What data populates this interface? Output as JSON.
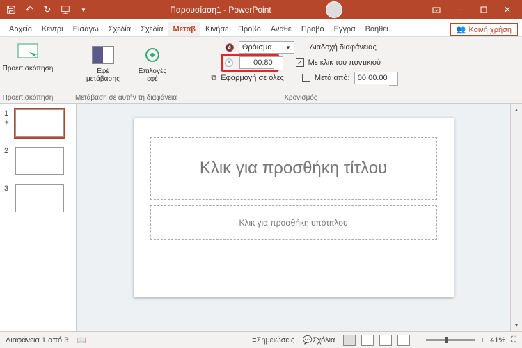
{
  "titlebar": {
    "title": "Παρουσίαση1 - PowerPoint"
  },
  "tabs": {
    "items": [
      "Αρχείο",
      "Κεντρι",
      "Εισαγω",
      "Σχεδία",
      "Σχεδία",
      "Μεταβ",
      "Κινήσε",
      "Προβο",
      "Αναθε",
      "Προβο",
      "Εγγρα",
      "Βοήθει"
    ],
    "active_index": 5,
    "share": "Κοινή χρήση"
  },
  "ribbon": {
    "preview": {
      "label": "Προεπισκόπηση",
      "group": "Προεπισκόπηση"
    },
    "trans_group": "Μετάβαση σε αυτήν τη διαφάνεια",
    "effect_opts": "Εφέ\nμετάβασης",
    "options": "Επιλογές\nεφέ",
    "timing_group": "Χρονισμός",
    "sound_label": "Θρόισμα",
    "duration_value": "00.80",
    "apply_all": "Εφαρμογή σε όλες",
    "advance_label": "Διαδοχή διαφάνειας",
    "on_click": "Με κλικ του ποντικιού",
    "after_label": "Μετά από:",
    "after_value": "00:00.00"
  },
  "thumbs": {
    "count": 3,
    "selected": 1
  },
  "slide": {
    "title_ph": "Κλικ για προσθήκη τίτλου",
    "sub_ph": "Κλικ για προσθήκη υπότιτλου"
  },
  "status": {
    "left": "Διαφάνεια 1 από 3",
    "notes": "Σημειώσεις",
    "comments": "Σχόλια",
    "zoom": "41%"
  }
}
